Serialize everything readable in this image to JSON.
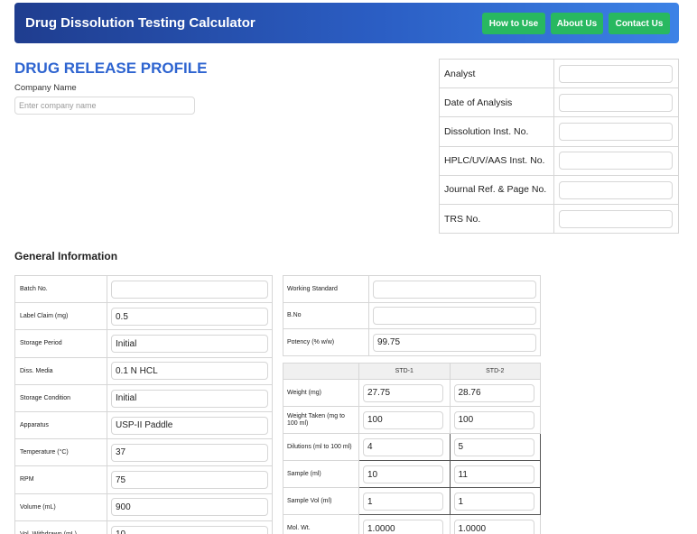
{
  "header": {
    "title": "Drug Dissolution Testing Calculator",
    "nav": [
      "How to Use",
      "About Us",
      "Contact Us"
    ]
  },
  "page_title": "DRUG RELEASE PROFILE",
  "company": {
    "label": "Company Name",
    "placeholder": "Enter company name",
    "value": ""
  },
  "analyst_fields": [
    {
      "label": "Analyst",
      "value": ""
    },
    {
      "label": "Date of Analysis",
      "value": ""
    },
    {
      "label": "Dissolution Inst. No.",
      "value": ""
    },
    {
      "label": "HPLC/UV/AAS Inst. No.",
      "value": ""
    },
    {
      "label": "Journal Ref. & Page No.",
      "value": ""
    },
    {
      "label": "TRS No.",
      "value": ""
    }
  ],
  "general_title": "General Information",
  "general_fields": [
    {
      "label": "Batch No.",
      "value": ""
    },
    {
      "label": "Label Claim (mg)",
      "value": "0.5"
    },
    {
      "label": "Storage Period",
      "value": "Initial"
    },
    {
      "label": "Diss. Media",
      "value": "0.1 N HCL"
    },
    {
      "label": "Storage Condition",
      "value": "Initial"
    },
    {
      "label": "Apparatus",
      "value": "USP-II Paddle"
    },
    {
      "label": "Temperature (°C)",
      "value": "37"
    },
    {
      "label": "RPM",
      "value": "75"
    },
    {
      "label": "Volume (mL)",
      "value": "900"
    },
    {
      "label": "Vol. Withdrawn (mL)",
      "value": "10"
    }
  ],
  "working_standard": [
    {
      "label": "Working Standard",
      "value": ""
    },
    {
      "label": "B.No",
      "value": ""
    },
    {
      "label": "Potency (% w/w)",
      "value": "99.75"
    }
  ],
  "std_table": {
    "headers": [
      "",
      "STD-1",
      "STD-2"
    ],
    "rows": [
      {
        "label": "Weight (mg)",
        "std1": "27.75",
        "std2": "28.76"
      },
      {
        "label": "Weight Taken (mg to 100 ml)",
        "std1": "100",
        "std2": "100"
      },
      {
        "label": "Dilutions (ml to 100 ml)",
        "std1": "4",
        "std2": "5"
      },
      {
        "label": "Sample (ml)",
        "std1": "10",
        "std2": "11"
      },
      {
        "label": "Sample Vol (ml)",
        "std1": "1",
        "std2": "1"
      },
      {
        "label": "Mol. Wt.",
        "std1": "1.0000",
        "std2": "1.0000"
      }
    ]
  }
}
